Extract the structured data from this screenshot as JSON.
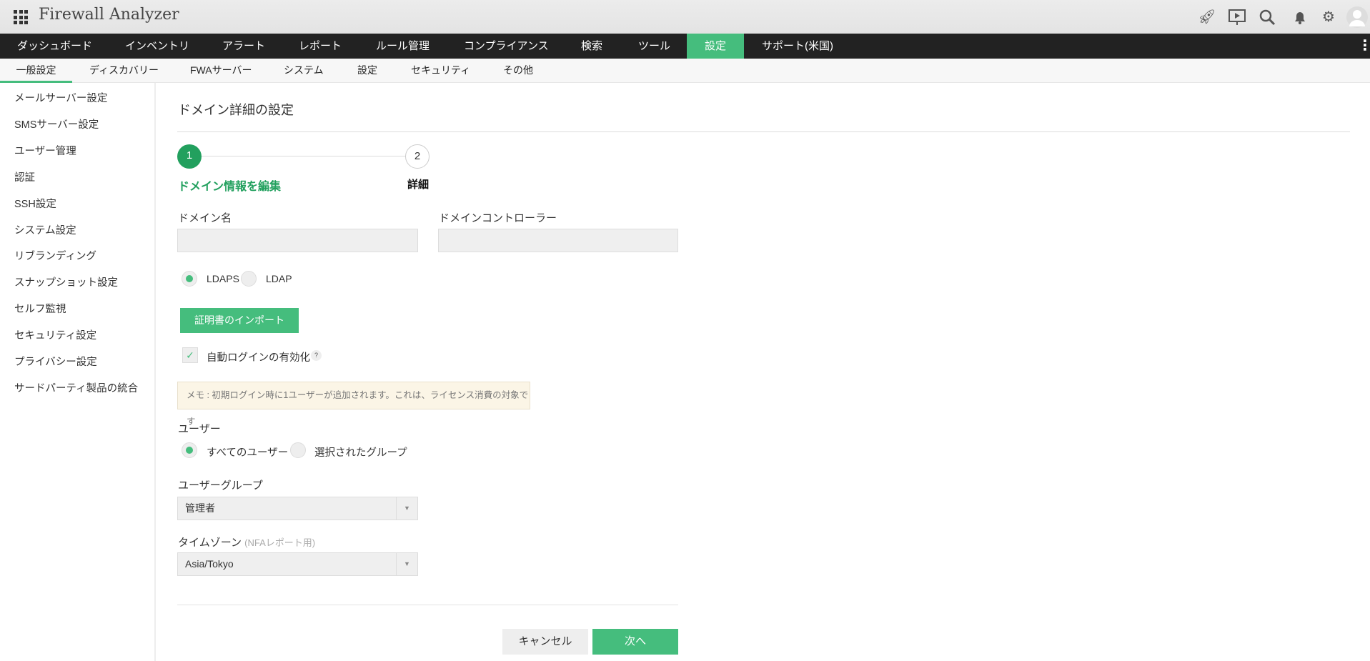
{
  "app": {
    "title": "Firewall Analyzer"
  },
  "header_icons": [
    "rocket-icon",
    "presentation-icon",
    "search-icon",
    "bell-icon",
    "gear-icon",
    "user-avatar-icon"
  ],
  "nav": {
    "items": [
      "ダッシュボード",
      "インベントリ",
      "アラート",
      "レポート",
      "ルール管理",
      "コンプライアンス",
      "検索",
      "ツール",
      "設定",
      "サポート(米国)"
    ],
    "active": "設定"
  },
  "subnav": {
    "items": [
      "一般設定",
      "ディスカバリー",
      "FWAサーバー",
      "システム",
      "設定",
      "セキュリティ",
      "その他"
    ],
    "active": "一般設定"
  },
  "sidebar": {
    "items": [
      "メールサーバー設定",
      "SMSサーバー設定",
      "ユーザー管理",
      "認証",
      "SSH設定",
      "システム設定",
      "リブランディング",
      "スナップショット設定",
      "セルフ監視",
      "セキュリティ設定",
      "プライバシー設定",
      "サードパーティ製品の統合"
    ]
  },
  "page": {
    "title": "ドメイン詳細の設定"
  },
  "stepper": {
    "steps": [
      {
        "number": "1",
        "label": "ドメイン情報を編集"
      },
      {
        "number": "2",
        "label": "詳細"
      }
    ],
    "current": 1
  },
  "form": {
    "domain_name_label": "ドメイン名",
    "domain_name_value": "",
    "domain_controller_label": "ドメインコントローラー",
    "domain_controller_value": "",
    "protocol_options": [
      "LDAPS",
      "LDAP"
    ],
    "protocol_selected": "LDAPS",
    "import_cert_button": "証明書のインポート",
    "auto_login_label": "自動ログインの有効化",
    "auto_login_checked": true,
    "help": "?",
    "note": "メモ : 初期ログイン時に1ユーザーが追加されます。これは、ライセンス消費の対象です",
    "user_label": "ユーザー",
    "user_options": [
      "すべてのユーザー",
      "選択されたグループ"
    ],
    "user_selected": "すべてのユーザー",
    "user_group_label": "ユーザーグループ",
    "user_group_value": "管理者",
    "timezone_label": "タイムゾーン",
    "timezone_hint": "(NFAレポート用)",
    "timezone_value": "Asia/Tokyo",
    "cancel_button": "キャンセル",
    "next_button": "次へ"
  },
  "colors": {
    "accent": "#45bd7d",
    "step_active": "#22a05e",
    "nav_bg": "#222222",
    "note_bg": "#fbf5e6"
  }
}
